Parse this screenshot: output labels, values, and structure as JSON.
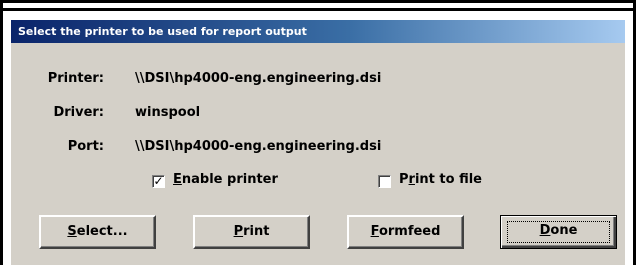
{
  "dialog": {
    "title": "Select the printer to be used for report output"
  },
  "fields": {
    "printer_label": "Printer:",
    "printer_value": "\\\\DSI\\hp4000-eng.engineering.dsi",
    "driver_label": "Driver:",
    "driver_value": "winspool",
    "port_label": "Port:",
    "port_value": "\\\\DSI\\hp4000-eng.engineering.dsi"
  },
  "options": {
    "enable_printer": {
      "label_prefix": "",
      "label_underline": "E",
      "label_rest": "nable printer",
      "checked": true
    },
    "print_to_file": {
      "label_prefix": "P",
      "label_underline": "r",
      "label_rest": "int to file",
      "checked": false
    }
  },
  "buttons": {
    "select": {
      "underline": "S",
      "rest": "elect..."
    },
    "print": {
      "underline": "P",
      "rest": "rint"
    },
    "formfeed": {
      "underline": "F",
      "rest": "ormfeed"
    },
    "done": {
      "underline": "D",
      "rest": "one"
    }
  },
  "colors": {
    "face": "#d4d0c8",
    "title_start": "#0a246a",
    "title_end": "#a6caf0"
  },
  "icons": {
    "checked_mark": "✓"
  }
}
